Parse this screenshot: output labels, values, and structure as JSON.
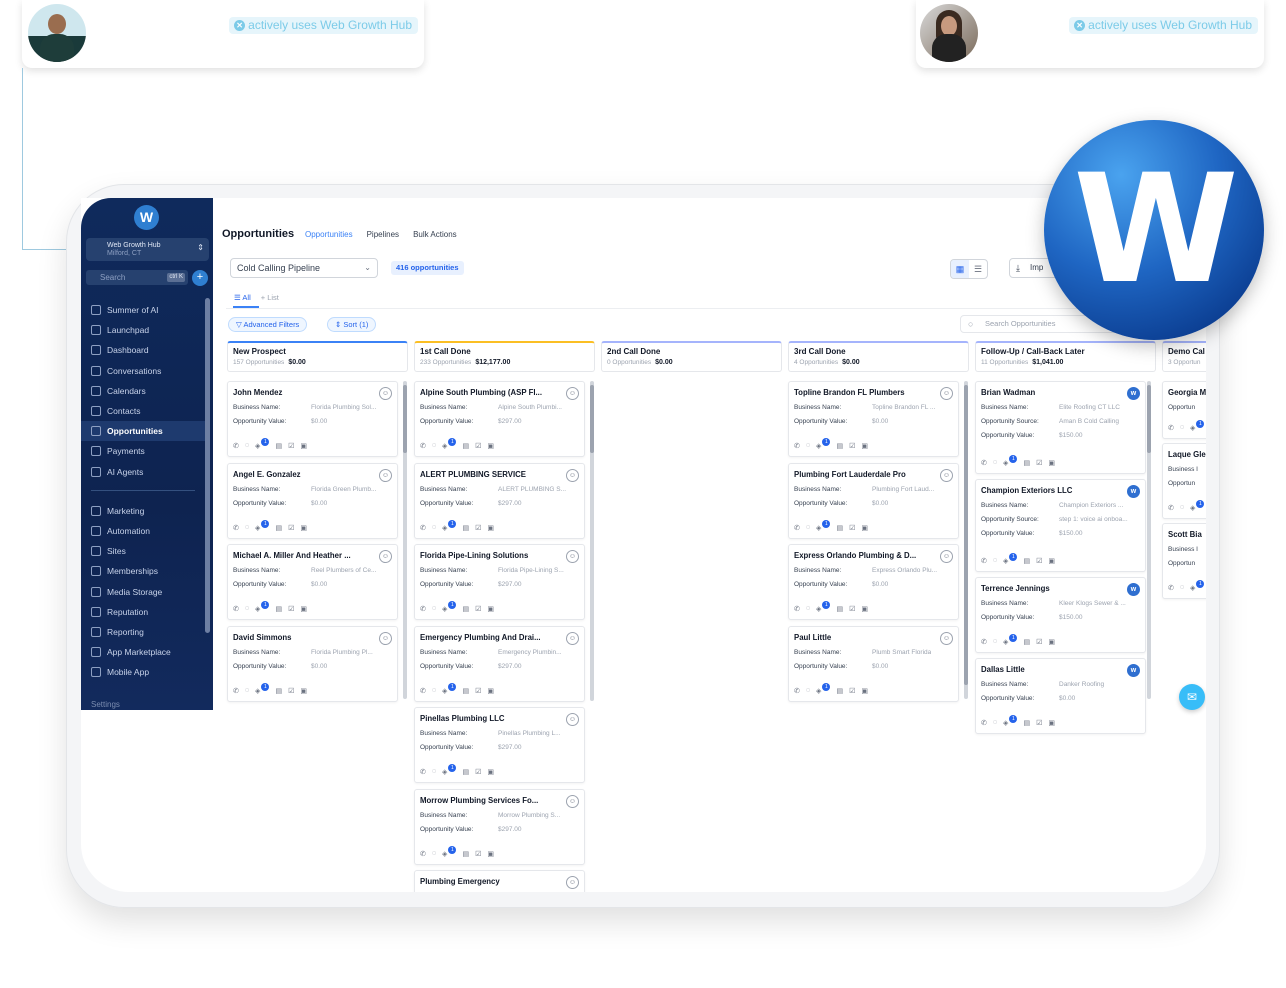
{
  "top_cards": [
    {
      "badge": "actively uses Web Growth Hub"
    },
    {
      "badge": "actively uses Web Growth Hub"
    }
  ],
  "sidebar": {
    "logo": "W",
    "account_name": "Web Growth Hub",
    "account_location": "Milford, CT",
    "search_placeholder": "Search",
    "search_shortcut": "ctrl K",
    "items": [
      {
        "label": "Summer of AI"
      },
      {
        "label": "Launchpad"
      },
      {
        "label": "Dashboard"
      },
      {
        "label": "Conversations"
      },
      {
        "label": "Calendars"
      },
      {
        "label": "Contacts"
      },
      {
        "label": "Opportunities",
        "active": true
      },
      {
        "label": "Payments"
      },
      {
        "label": "AI Agents"
      }
    ],
    "items2": [
      {
        "label": "Marketing"
      },
      {
        "label": "Automation"
      },
      {
        "label": "Sites"
      },
      {
        "label": "Memberships"
      },
      {
        "label": "Media Storage"
      },
      {
        "label": "Reputation"
      },
      {
        "label": "Reporting"
      },
      {
        "label": "App Marketplace"
      },
      {
        "label": "Mobile App"
      }
    ],
    "settings": "Settings"
  },
  "header": {
    "title": "Opportunities",
    "tabs": [
      "Opportunities",
      "Pipelines",
      "Bulk Actions"
    ],
    "pipeline": "Cold Calling Pipeline",
    "count": "416 opportunities",
    "import": "Imp",
    "list_tabs": [
      "All",
      "+ List"
    ],
    "filters": [
      "Advanced Filters",
      "Sort (1)"
    ],
    "search_placeholder": "Search Opportunities"
  },
  "columns": [
    {
      "name": "New Prospect",
      "count": "157 Opportunities",
      "value": "$0.00",
      "color": "#3b82f6",
      "cards": [
        {
          "title": "John Mendez",
          "rows": [
            [
              "Business Name:",
              "Florida Plumbing Sol..."
            ],
            [
              "Opportunity Value:",
              "$0.00"
            ]
          ]
        },
        {
          "title": "Angel E. Gonzalez",
          "rows": [
            [
              "Business Name:",
              "Florida Green Plumb..."
            ],
            [
              "Opportunity Value:",
              "$0.00"
            ]
          ]
        },
        {
          "title": "Michael A. Miller And Heather ...",
          "rows": [
            [
              "Business Name:",
              "Reel Plumbers of Ce..."
            ],
            [
              "Opportunity Value:",
              "$0.00"
            ]
          ]
        },
        {
          "title": "David Simmons",
          "rows": [
            [
              "Business Name:",
              "Florida Plumbing Pl..."
            ],
            [
              "Opportunity Value:",
              "$0.00"
            ]
          ]
        }
      ]
    },
    {
      "name": "1st Call Done",
      "count": "233 Opportunities",
      "value": "$12,177.00",
      "color": "#fbbf24",
      "cards": [
        {
          "title": "Alpine South Plumbing (ASP Fl...",
          "rows": [
            [
              "Business Name:",
              "Alpine South Plumbi..."
            ],
            [
              "Opportunity Value:",
              "$297.00"
            ]
          ]
        },
        {
          "title": "ALERT PLUMBING SERVICE",
          "rows": [
            [
              "Business Name:",
              "ALERT PLUMBING S..."
            ],
            [
              "Opportunity Value:",
              "$297.00"
            ]
          ]
        },
        {
          "title": "Florida Pipe-Lining Solutions",
          "rows": [
            [
              "Business Name:",
              "Florida Pipe-Lining S..."
            ],
            [
              "Opportunity Value:",
              "$297.00"
            ]
          ]
        },
        {
          "title": "Emergency Plumbing And Drai...",
          "rows": [
            [
              "Business Name:",
              "Emergency Plumbin..."
            ],
            [
              "Opportunity Value:",
              "$297.00"
            ]
          ]
        },
        {
          "title": "Pinellas Plumbing LLC",
          "rows": [
            [
              "Business Name:",
              "Pinellas Plumbing L..."
            ],
            [
              "Opportunity Value:",
              "$297.00"
            ]
          ]
        },
        {
          "title": "Morrow Plumbing Services Fo...",
          "rows": [
            [
              "Business Name:",
              "Morrow Plumbing S..."
            ],
            [
              "Opportunity Value:",
              "$297.00"
            ]
          ]
        },
        {
          "title": "Plumbing Emergency",
          "rows": []
        }
      ]
    },
    {
      "name": "2nd Call Done",
      "count": "0 Opportunities",
      "value": "$0.00",
      "color": "#a5b4fc",
      "cards": []
    },
    {
      "name": "3rd Call Done",
      "count": "4 Opportunities",
      "value": "$0.00",
      "color": "#a5b4fc",
      "cards": [
        {
          "title": "Topline Brandon FL Plumbers",
          "rows": [
            [
              "Business Name:",
              "Topline Brandon FL ..."
            ],
            [
              "Opportunity Value:",
              "$0.00"
            ]
          ]
        },
        {
          "title": "Plumbing Fort Lauderdale Pro",
          "rows": [
            [
              "Business Name:",
              "Plumbing Fort Laud..."
            ],
            [
              "Opportunity Value:",
              "$0.00"
            ]
          ]
        },
        {
          "title": "Express Orlando Plumbing & D...",
          "rows": [
            [
              "Business Name:",
              "Express Orlando Plu..."
            ],
            [
              "Opportunity Value:",
              "$0.00"
            ]
          ]
        },
        {
          "title": "Paul Little",
          "rows": [
            [
              "Business Name:",
              "Plumb Smart Florida"
            ],
            [
              "Opportunity Value:",
              "$0.00"
            ]
          ]
        }
      ]
    },
    {
      "name": "Follow-Up / Call-Back Later",
      "count": "11 Opportunities",
      "value": "$1,041.00",
      "color": "#a5b4fc",
      "cards": [
        {
          "title": "Brian Wadman",
          "rows": [
            [
              "Business Name:",
              "Elite Roofing CT LLC"
            ],
            [
              "Opportunity Source:",
              "Aman B Cold Calling"
            ],
            [
              "Opportunity Value:",
              "$150.00"
            ]
          ]
        },
        {
          "title": "Champion Exteriors LLC",
          "rows": [
            [
              "Business Name:",
              "Champion Exteriors ..."
            ],
            [
              "Opportunity Source:",
              "step 1: voice ai onboa..."
            ],
            [
              "Opportunity Value:",
              "$150.00"
            ]
          ]
        },
        {
          "title": "Terrence Jennings",
          "rows": [
            [
              "Business Name:",
              "Kleer Klogs Sewer & ..."
            ],
            [
              "Opportunity Value:",
              "$150.00"
            ]
          ]
        },
        {
          "title": "Dallas Little",
          "rows": [
            [
              "Business Name:",
              "Danker Roofing"
            ],
            [
              "Opportunity Value:",
              "$0.00"
            ]
          ]
        }
      ]
    },
    {
      "name": "Demo Cal",
      "count": "3 Opportun",
      "value": "",
      "color": "#a5b4fc",
      "cards": [
        {
          "title": "Georgia M",
          "rows": [
            [
              "Opportun",
              ""
            ]
          ]
        },
        {
          "title": "Laque Gle",
          "rows": [
            [
              "Business I",
              ""
            ],
            [
              "Opportun",
              ""
            ]
          ]
        },
        {
          "title": "Scott Bia",
          "rows": [
            [
              "Business I",
              ""
            ],
            [
              "Opportun",
              ""
            ]
          ]
        }
      ]
    }
  ],
  "logo_letter": "W",
  "colors": {
    "accent": "#3b82f6",
    "sidebar": "#0f2a5c"
  }
}
